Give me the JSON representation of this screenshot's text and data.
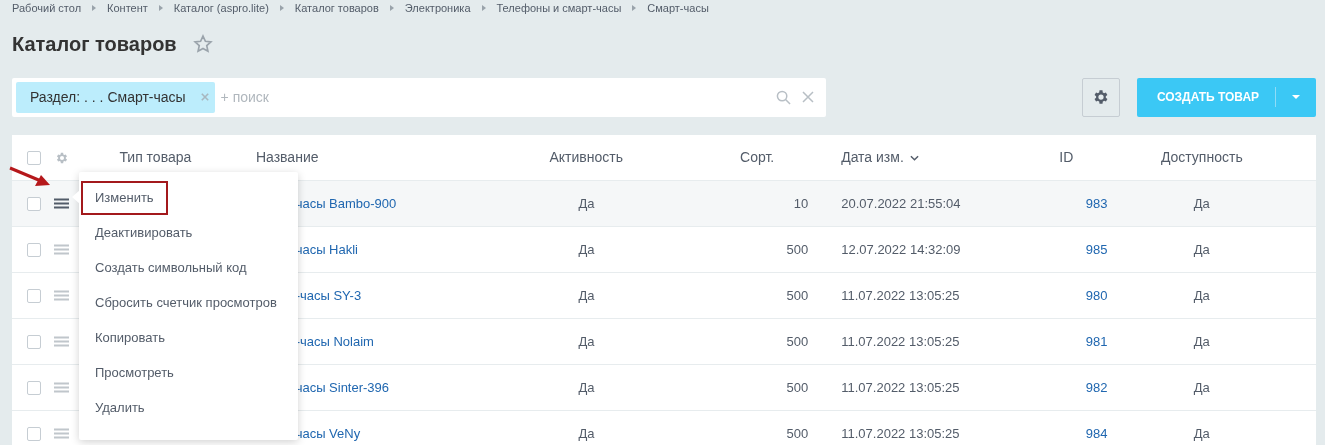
{
  "breadcrumbs": [
    "Рабочий стол",
    "Контент",
    "Каталог (aspro.lite)",
    "Каталог товаров",
    "Электроника",
    "Телефоны и смарт-часы",
    "Смарт-часы"
  ],
  "title": "Каталог товаров",
  "favorite": false,
  "filter": {
    "tag": "Раздел: . . . Смарт-часы",
    "placeholder": "+ поиск"
  },
  "create_button": {
    "label": "СОЗДАТЬ ТОВАР"
  },
  "table": {
    "header_checked": false,
    "columns": [
      "Тип товара",
      "Название",
      "Активность",
      "Сорт.",
      "Дата изм.",
      "ID",
      "Доступность"
    ],
    "rows": [
      {
        "checked": false,
        "hovered": true,
        "name": "часы Bambo-900",
        "activity": "Да",
        "sort": "10",
        "date": "20.07.2022 21:55:04",
        "id": "983",
        "availability": "Да"
      },
      {
        "checked": false,
        "hovered": false,
        "name": "часы Hakli",
        "activity": "Да",
        "sort": "500",
        "date": "12.07.2022 14:32:09",
        "id": "985",
        "availability": "Да"
      },
      {
        "checked": false,
        "hovered": false,
        "name": "-часы SY-3",
        "activity": "Да",
        "sort": "500",
        "date": "11.07.2022 13:05:25",
        "id": "980",
        "availability": "Да"
      },
      {
        "checked": false,
        "hovered": false,
        "name": "-часы Nolaim",
        "activity": "Да",
        "sort": "500",
        "date": "11.07.2022 13:05:25",
        "id": "981",
        "availability": "Да"
      },
      {
        "checked": false,
        "hovered": false,
        "name": "часы Sinter-396",
        "activity": "Да",
        "sort": "500",
        "date": "11.07.2022 13:05:25",
        "id": "982",
        "availability": "Да"
      },
      {
        "checked": false,
        "hovered": false,
        "name": "часы VeNy",
        "activity": "Да",
        "sort": "500",
        "date": "11.07.2022 13:05:25",
        "id": "984",
        "availability": "Да"
      }
    ]
  },
  "context_menu": {
    "items": [
      {
        "label": "Изменить",
        "highlighted": true
      },
      {
        "label": "Деактивировать",
        "highlighted": false
      },
      {
        "label": "Создать символьный код",
        "highlighted": false
      },
      {
        "label": "Сбросить счетчик просмотров",
        "highlighted": false
      },
      {
        "label": "Копировать",
        "highlighted": false
      },
      {
        "label": "Просмотреть",
        "highlighted": false
      },
      {
        "label": "Удалить",
        "highlighted": false
      }
    ]
  }
}
